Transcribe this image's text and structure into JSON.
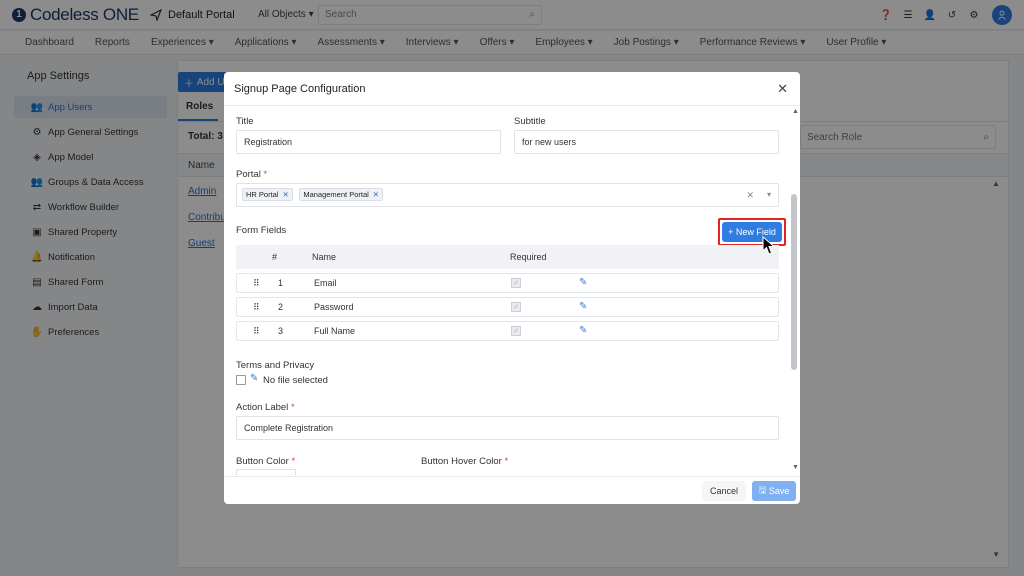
{
  "topbar": {
    "logo_mark": "1",
    "logo_text": "Codeless ONE",
    "portal_name": "Default Portal",
    "object_select": "All Objects",
    "search_placeholder": "Search",
    "icons": [
      "help-icon",
      "database-icon",
      "add-user-icon",
      "history-icon",
      "gear-icon",
      "user-avatar-icon"
    ]
  },
  "nav": {
    "items": [
      "Dashboard",
      "Reports",
      "Experiences ▾",
      "Applications ▾",
      "Assessments ▾",
      "Interviews ▾",
      "Offers ▾",
      "Employees ▾",
      "Job Postings ▾",
      "Performance Reviews ▾",
      "User Profile ▾"
    ]
  },
  "sidebar": {
    "title": "App Settings",
    "items": [
      {
        "label": "App Users",
        "icon": "users-icon",
        "active": true
      },
      {
        "label": "App General Settings",
        "icon": "gear-icon"
      },
      {
        "label": "App Model",
        "icon": "model-icon"
      },
      {
        "label": "Groups & Data Access",
        "icon": "groups-icon"
      },
      {
        "label": "Workflow Builder",
        "icon": "workflow-icon"
      },
      {
        "label": "Shared Property",
        "icon": "property-icon"
      },
      {
        "label": "Notification",
        "icon": "bell-icon"
      },
      {
        "label": "Shared Form",
        "icon": "form-icon"
      },
      {
        "label": "Import Data",
        "icon": "cloud-upload-icon"
      },
      {
        "label": "Preferences",
        "icon": "preferences-icon"
      }
    ]
  },
  "main": {
    "add_button": "Add Us",
    "tab": "Roles",
    "total": "Total: 3",
    "column_name": "Name",
    "search_placeholder": "Search Role",
    "roles": [
      "Admin",
      "Contribut",
      "Guest"
    ]
  },
  "modal": {
    "title": "Signup Page Configuration",
    "title_label": "Title",
    "title_value": "Registration",
    "subtitle_label": "Subtitle",
    "subtitle_value": "for new users",
    "portal_label": "Portal",
    "portal_chips": [
      "HR Portal",
      "Management Portal"
    ],
    "form_fields_label": "Form Fields",
    "new_field_button": "+ New Field",
    "columns": {
      "num": "#",
      "name": "Name",
      "required": "Required"
    },
    "fields": [
      {
        "num": "1",
        "name": "Email"
      },
      {
        "num": "2",
        "name": "Password"
      },
      {
        "num": "3",
        "name": "Full Name"
      }
    ],
    "terms_label": "Terms and Privacy",
    "no_file": "No file selected",
    "action_label": "Action Label",
    "action_value": "Complete Registration",
    "button_color_label": "Button Color",
    "button_hover_color_label": "Button Hover Color",
    "cancel": "Cancel",
    "save": "Save"
  },
  "colors": {
    "accent": "#2f7de1",
    "highlight": "#e02525",
    "logo": "#1b3a6b"
  }
}
